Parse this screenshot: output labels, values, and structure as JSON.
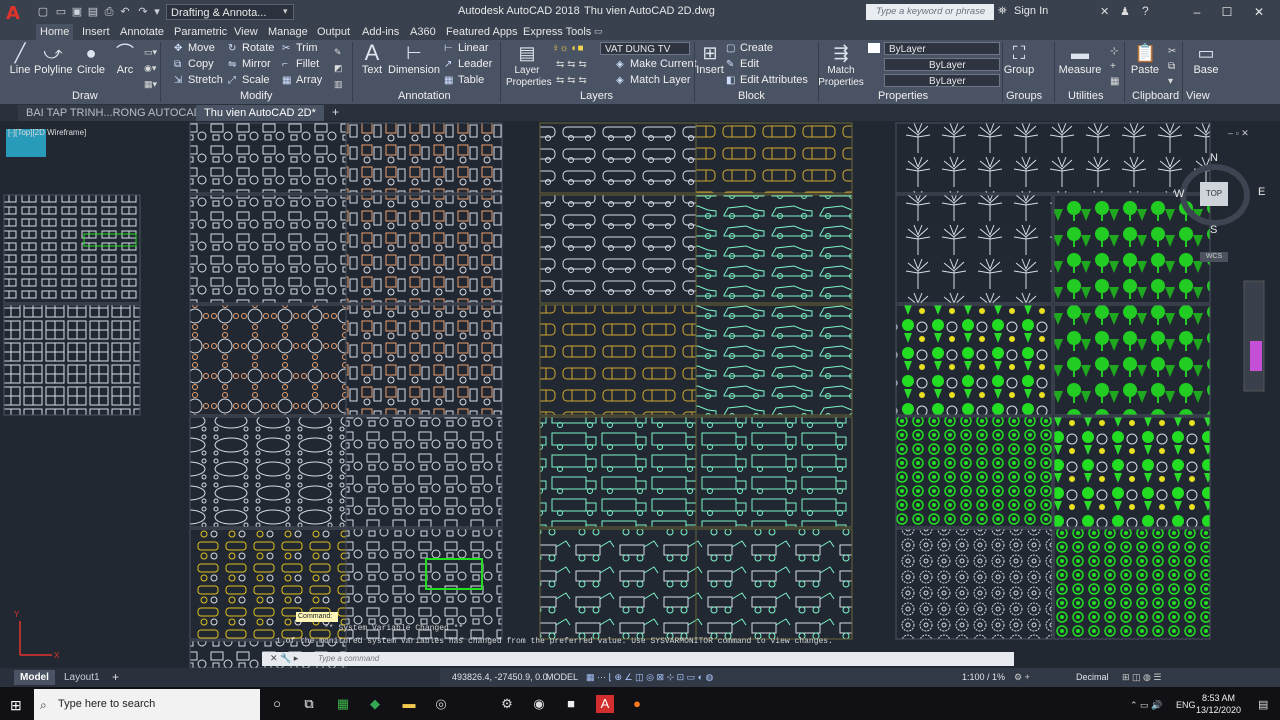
{
  "titlebar": {
    "workspace": "Drafting & Annota...",
    "app_title": "Autodesk AutoCAD 2018",
    "doc_title": "Thu vien AutoCAD 2D.dwg",
    "search_placeholder": "Type a keyword or phrase",
    "sign_in": "Sign In"
  },
  "ribbon_tabs": [
    "Home",
    "Insert",
    "Annotate",
    "Parametric",
    "View",
    "Manage",
    "Output",
    "Add-ins",
    "A360",
    "Featured Apps",
    "Express Tools"
  ],
  "draw_panel": {
    "title": "Draw",
    "buttons": [
      "Line",
      "Polyline",
      "Circle",
      "Arc"
    ]
  },
  "modify_panel": {
    "title": "Modify",
    "items": [
      "Move",
      "Rotate",
      "Trim",
      "Copy",
      "Mirror",
      "Fillet",
      "Stretch",
      "Scale",
      "Array"
    ]
  },
  "annotation_panel": {
    "title": "Annotation",
    "big": [
      "Text",
      "Dimension"
    ],
    "items": [
      "Linear",
      "Leader",
      "Table"
    ]
  },
  "layers_panel": {
    "title": "Layers",
    "big": "Layer Properties",
    "layer_name": "VAT DUNG TV",
    "items": [
      "Make Current",
      "Match Layer"
    ]
  },
  "block_panel": {
    "title": "Block",
    "big": "Insert",
    "items": [
      "Create",
      "Edit",
      "Edit Attributes"
    ]
  },
  "properties_panel": {
    "title": "Properties",
    "big": "Match Properties",
    "rows": [
      "ByLayer",
      "ByLayer",
      "ByLayer"
    ]
  },
  "groups_panel": {
    "title": "Groups",
    "big": "Group"
  },
  "utilities_panel": {
    "title": "Utilities",
    "big": "Measure"
  },
  "clipboard_panel": {
    "title": "Clipboard",
    "big": "Paste"
  },
  "view_panel": {
    "title": "View",
    "big": "Base"
  },
  "doc_tabs": [
    "BAI TAP TRINH...RONG AUTOCAD*",
    "Thu vien AutoCAD 2D*"
  ],
  "viewport_label": "[-][Top][2D Wireframe]",
  "viewcube": {
    "n": "N",
    "s": "S",
    "w": "W",
    "e": "E",
    "top": "TOP",
    "wcs": "WCS"
  },
  "command": {
    "tooltip": "Command:",
    "line1": "** System Variable Changed **",
    "line2": "1 of the monitored system variables has changed from the preferred value. Use SYSVARMONITOR command to view changes.",
    "placeholder": "Type a command"
  },
  "model_tabs": [
    "Model",
    "Layout1"
  ],
  "status": {
    "coords": "493826.4, -27450.9, 0.0",
    "model": "MODEL",
    "scale": "1:100 / 1%",
    "units": "Decimal"
  },
  "taskbar": {
    "search_placeholder": "Type here to search",
    "lang": "ENG",
    "time": "8:53 AM",
    "date": "13/12/2020"
  },
  "colors": {
    "accent_red": "#e0332b",
    "cyan_lines": "#7df5c8",
    "green_trees": "#22dd22",
    "yellow_lines": "#e0c020",
    "orange_lines": "#e8a070",
    "ribbon_bg": "#4a5363",
    "canvas_bg": "#212832"
  }
}
